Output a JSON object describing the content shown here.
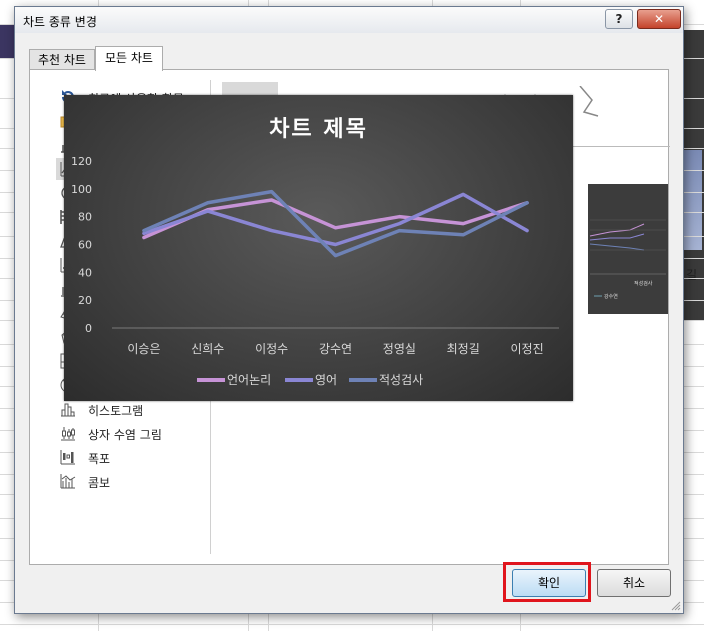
{
  "dialog": {
    "title": "차트 종류 변경",
    "help_label": "?",
    "close_label": "✕",
    "tabs": [
      {
        "label": "추천 차트",
        "selected": false
      },
      {
        "label": "모든 차트",
        "selected": true
      }
    ],
    "categories": [
      {
        "label": "최근에 사용한 항목",
        "icon": "recent-icon"
      },
      {
        "label": "",
        "icon": "template-folder-icon"
      },
      {
        "label": "",
        "icon": "column-chart-icon"
      },
      {
        "label": "",
        "icon": "line-chart-icon"
      },
      {
        "label": "",
        "icon": "pie-chart-icon"
      },
      {
        "label": "",
        "icon": "bar-chart-icon"
      },
      {
        "label": "",
        "icon": "area-chart-icon"
      },
      {
        "label": "",
        "icon": "scatter-chart-icon"
      },
      {
        "label": "",
        "icon": "stock-chart-icon"
      },
      {
        "label": "",
        "icon": "surface-chart-icon"
      },
      {
        "label": "",
        "icon": "radar-chart-icon"
      },
      {
        "label": "",
        "icon": "treemap-chart-icon"
      },
      {
        "label": "",
        "icon": "sunburst-chart-icon"
      },
      {
        "label": "히스토그램",
        "icon": "histogram-chart-icon"
      },
      {
        "label": "상자 수염 그림",
        "icon": "box-whisker-chart-icon"
      },
      {
        "label": "폭포",
        "icon": "waterfall-chart-icon"
      },
      {
        "label": "콤보",
        "icon": "combo-chart-icon"
      }
    ],
    "preview_legend_text": "강수연",
    "preview_axis_text": "적성검사",
    "ok_label": "확인",
    "cancel_label": "취소"
  },
  "sheet": {
    "right_edge_text": "길"
  },
  "colors": {
    "highlight_box": "#e0151c",
    "chart_background": "#404040",
    "series_language": "#c693d6",
    "series_english": "#8a86d4",
    "series_aptitude": "#6e82b6"
  },
  "chart_data": {
    "type": "line",
    "title": "차트 제목",
    "categories": [
      "이승은",
      "신희수",
      "이정수",
      "강수연",
      "정영실",
      "최정길",
      "이정진"
    ],
    "series": [
      {
        "name": "언어논리",
        "values": [
          65,
          85,
          92,
          72,
          80,
          75,
          90
        ]
      },
      {
        "name": "영어",
        "values": [
          68,
          84,
          70,
          60,
          75,
          96,
          70
        ]
      },
      {
        "name": "적성검사",
        "values": [
          70,
          90,
          98,
          52,
          70,
          67,
          90
        ]
      }
    ],
    "yticks": [
      0,
      20,
      40,
      60,
      80,
      100,
      120
    ],
    "ylim": [
      0,
      120
    ],
    "grid": false,
    "legend_position": "bottom"
  }
}
